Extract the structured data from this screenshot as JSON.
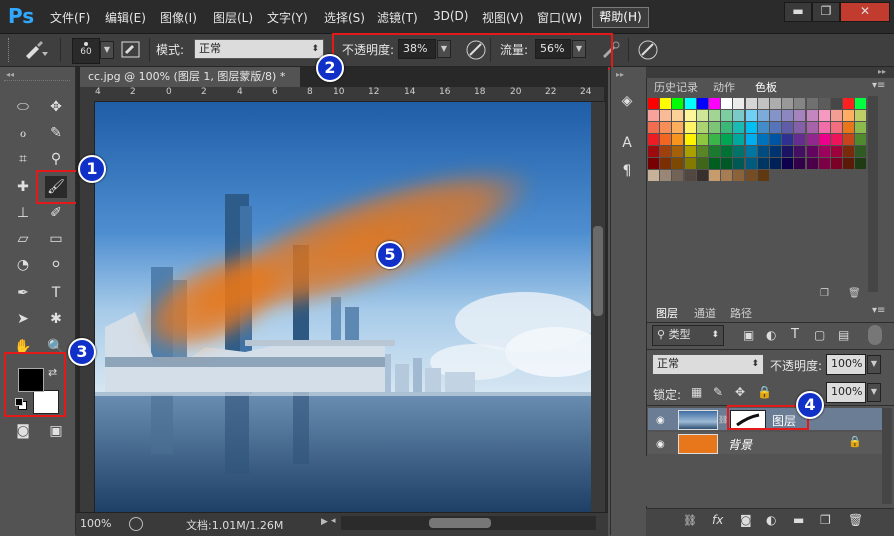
{
  "app": {
    "logo": "Ps"
  },
  "menu": {
    "items": [
      "文件(F)",
      "编辑(E)",
      "图像(I)",
      "图层(L)",
      "文字(Y)",
      "选择(S)",
      "滤镜(T)",
      "3D(D)",
      "视图(V)",
      "窗口(W)"
    ],
    "help": "帮助(H)"
  },
  "window_controls": {
    "minimize": "▬",
    "restore": "❐",
    "close": "✕"
  },
  "options": {
    "brush_size": "60",
    "mode_label": "模式:",
    "mode_value": "正常",
    "opacity_label": "不透明度:",
    "opacity_value": "38%",
    "flow_label": "流量:",
    "flow_value": "56%"
  },
  "document": {
    "tab_title": "cc.jpg @ 100% (图层 1, 图层蒙版/8) *",
    "tab_close": "×",
    "ruler_ticks": [
      "4",
      "2",
      "0",
      "2",
      "4",
      "6",
      "8",
      "10",
      "12",
      "14",
      "16",
      "18",
      "20",
      "22",
      "24"
    ],
    "zoom": "100%",
    "doc_size": "文档:1.01M/1.26M"
  },
  "panels": {
    "tabs": [
      "历史记录",
      "动作",
      "色板"
    ],
    "active_tab": "色板"
  },
  "layers_panel": {
    "tabs": [
      "图层",
      "通道",
      "路径"
    ],
    "filter_label": "类型",
    "blend_mode": "正常",
    "opacity_label": "不透明度:",
    "opacity_value": "100%",
    "lock_label": "锁定:",
    "fill_value": "100%",
    "layers": [
      {
        "name": "图层",
        "visible": true
      },
      {
        "name": "背景",
        "visible": true,
        "locked": true
      }
    ],
    "footer_icons": [
      "link-icon",
      "fx-icon",
      "mask-icon",
      "adjustment-icon",
      "folder-icon",
      "new-layer-icon",
      "trash-icon"
    ]
  },
  "annotations": [
    "1",
    "2",
    "3",
    "4",
    "5"
  ],
  "colors": {
    "foreground": "#000000",
    "background": "#ffffff",
    "highlight": "#e21a1a",
    "badge": "#1030c8",
    "brush_stroke": "#e8761a"
  }
}
